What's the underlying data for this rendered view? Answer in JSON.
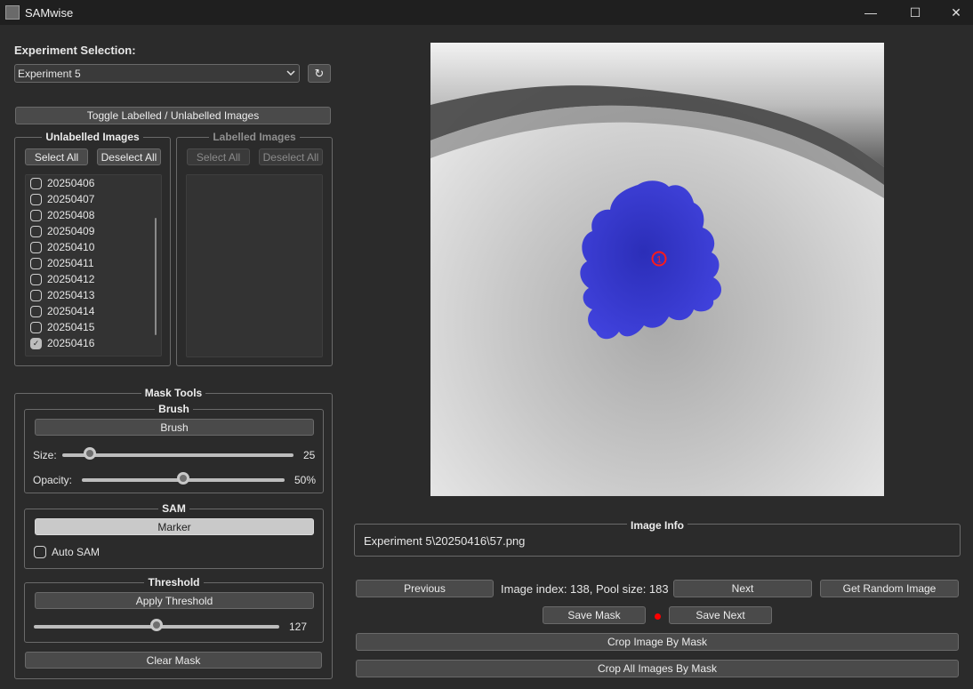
{
  "window": {
    "title": "SAMwise",
    "minimize_glyph": "—",
    "maximize_glyph": "☐",
    "close_glyph": "✕"
  },
  "experiment": {
    "heading": "Experiment Selection:",
    "selected": "Experiment 5",
    "refresh_glyph": "↻"
  },
  "toggle_label": "Toggle Labelled / Unlabelled Images",
  "unlabelled": {
    "title": "Unlabelled Images",
    "select_all": "Select All",
    "deselect_all": "Deselect All",
    "items": [
      {
        "label": "20250406",
        "checked": false
      },
      {
        "label": "20250407",
        "checked": false
      },
      {
        "label": "20250408",
        "checked": false
      },
      {
        "label": "20250409",
        "checked": false
      },
      {
        "label": "20250410",
        "checked": false
      },
      {
        "label": "20250411",
        "checked": false
      },
      {
        "label": "20250412",
        "checked": false
      },
      {
        "label": "20250413",
        "checked": false
      },
      {
        "label": "20250414",
        "checked": false
      },
      {
        "label": "20250415",
        "checked": false
      },
      {
        "label": "20250416",
        "checked": true
      }
    ]
  },
  "labelled": {
    "title": "Labelled Images",
    "select_all": "Select All",
    "deselect_all": "Deselect All"
  },
  "mask_tools": {
    "title": "Mask Tools",
    "brush": {
      "title": "Brush",
      "button": "Brush",
      "size_label": "Size:",
      "size_value": "25",
      "size_fraction": 0.12,
      "opacity_label": "Opacity:",
      "opacity_value": "50%",
      "opacity_fraction": 0.5
    },
    "sam": {
      "title": "SAM",
      "marker_button": "Marker",
      "auto_sam_label": "Auto SAM",
      "auto_sam_checked": false
    },
    "threshold": {
      "title": "Threshold",
      "apply_button": "Apply Threshold",
      "value": "127",
      "fraction": 0.5
    },
    "clear_button": "Clear Mask"
  },
  "viewer": {
    "marker_number": "1",
    "mask_color": "#2a2ad8"
  },
  "image_info": {
    "title": "Image Info",
    "path": "Experiment 5\\20250416\\57.png"
  },
  "navigation": {
    "previous": "Previous",
    "index_text": "Image index: 138, Pool size: 183",
    "next": "Next",
    "random": "Get Random Image",
    "save_mask": "Save Mask",
    "save_next": "Save  Next",
    "unsaved_indicator_color": "#ff0000",
    "crop_image": "Crop Image By Mask",
    "crop_all": "Crop All Images By Mask"
  }
}
